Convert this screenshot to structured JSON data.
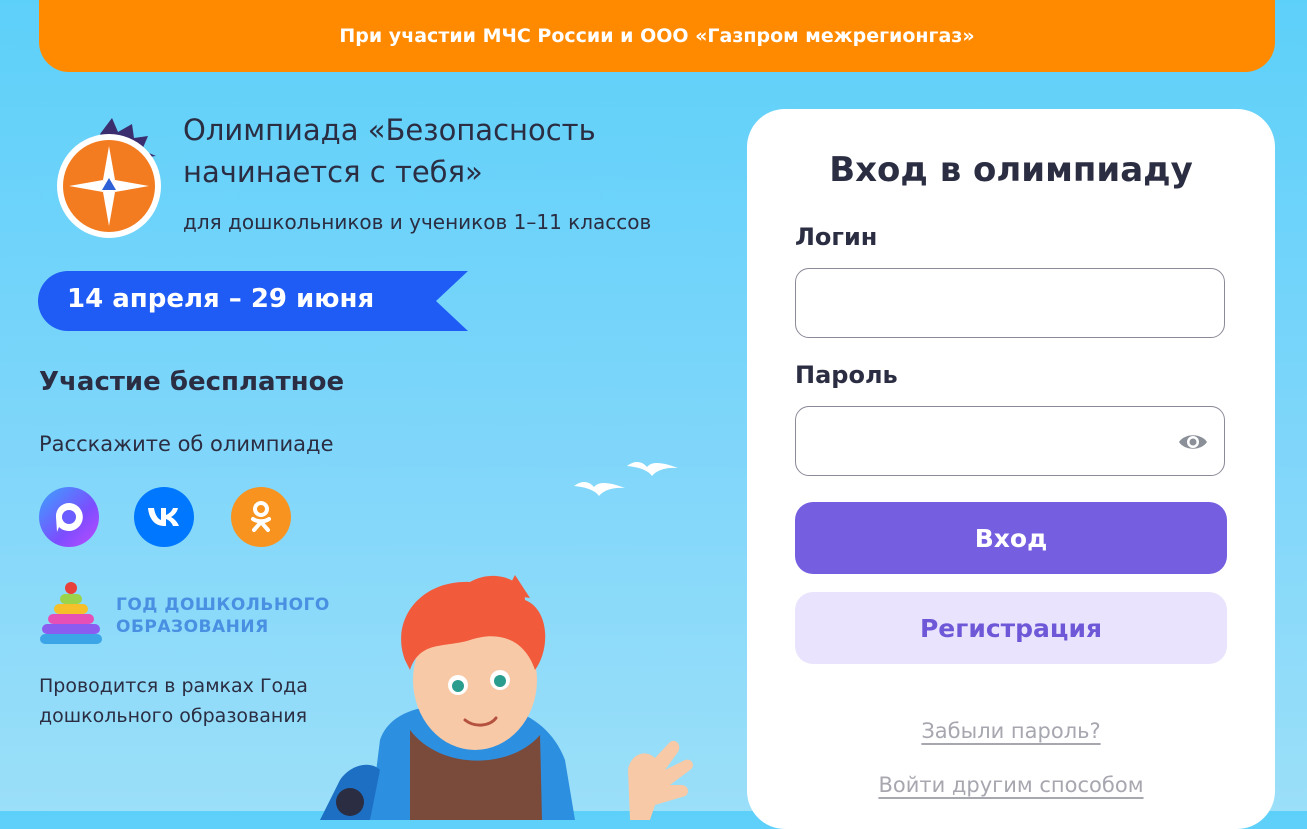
{
  "banner": {
    "text": "При участии МЧС России и ООО «Газпром межрегионгаз»"
  },
  "olympiad": {
    "title": "Олимпиада «Безопасность начинается с тебя»",
    "subtitle": "для дошкольников и учеников 1–11 классов",
    "dates": "14 апреля – 29 июня",
    "free_label": "Участие бесплатное",
    "share_label": "Расскажите об олимпиаде"
  },
  "social": [
    {
      "icon": "max-messenger-icon",
      "color": "#6a5cff"
    },
    {
      "icon": "vk-icon",
      "color": "#0077ff"
    },
    {
      "icon": "odnoklassniki-icon",
      "color": "#f7931e"
    }
  ],
  "year_program": {
    "logo_text_line1": "Год дошкольного",
    "logo_text_line2": "образования",
    "held_label": "Проводится в рамках Года дошкольного образования"
  },
  "login": {
    "title": "Вход в олимпиаду",
    "login_label": "Логин",
    "login_value": "",
    "password_label": "Пароль",
    "password_value": "",
    "login_button": "Вход",
    "register_button": "Регистрация",
    "forgot_link": "Забыли пароль?",
    "other_method_link": "Войти другим способом"
  },
  "colors": {
    "banner": "#ff8a00",
    "date_ribbon": "#1f5bf5",
    "primary_button": "#755ee0",
    "secondary_button": "#e9e3fd"
  }
}
